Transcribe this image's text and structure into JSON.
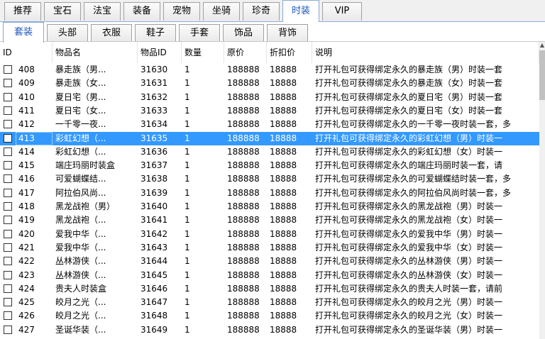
{
  "tabs_primary": [
    {
      "label": "推荐",
      "active": false
    },
    {
      "label": "宝石",
      "active": false
    },
    {
      "label": "法宝",
      "active": false
    },
    {
      "label": "装备",
      "active": false
    },
    {
      "label": "宠物",
      "active": false
    },
    {
      "label": "坐骑",
      "active": false
    },
    {
      "label": "珍奇",
      "active": false
    },
    {
      "label": "时装",
      "active": true
    },
    {
      "label": "VIP",
      "active": false
    }
  ],
  "tabs_secondary": [
    {
      "label": "套装",
      "active": true
    },
    {
      "label": "头部",
      "active": false
    },
    {
      "label": "衣服",
      "active": false
    },
    {
      "label": "鞋子",
      "active": false
    },
    {
      "label": "手套",
      "active": false
    },
    {
      "label": "饰品",
      "active": false
    },
    {
      "label": "背饰",
      "active": false
    }
  ],
  "columns": [
    "ID",
    "物品名",
    "物品ID",
    "数量",
    "原价",
    "折扣价",
    "说明"
  ],
  "selected_id": "413",
  "colors": {
    "selection": "#3399ff",
    "active_tab_text": "#1e58c0"
  },
  "rows": [
    {
      "id": "408",
      "name": "暴走族（男...",
      "item_id": "31630",
      "qty": "1",
      "price": "188888",
      "discount": "18888",
      "desc": "打开礼包可获得绑定永久的暴走族（男）时装一套"
    },
    {
      "id": "409",
      "name": "暴走族（女...",
      "item_id": "31631",
      "qty": "1",
      "price": "188888",
      "discount": "18888",
      "desc": "打开礼包可获得绑定永久的暴走族（女）时装一套"
    },
    {
      "id": "410",
      "name": "夏日宅（男...",
      "item_id": "31632",
      "qty": "1",
      "price": "188888",
      "discount": "18888",
      "desc": "打开礼包可获得绑定永久的夏日宅（男）时装一套"
    },
    {
      "id": "411",
      "name": "夏日宅（女...",
      "item_id": "31633",
      "qty": "1",
      "price": "188888",
      "discount": "18888",
      "desc": "打开礼包可获得绑定永久的夏日宅（女）时装一套"
    },
    {
      "id": "412",
      "name": "一千零一夜...",
      "item_id": "31634",
      "qty": "1",
      "price": "188888",
      "discount": "18888",
      "desc": "打开礼包可获得绑定永久的一千零一夜时装一套，多"
    },
    {
      "id": "413",
      "name": "彩虹幻想（...",
      "item_id": "31635",
      "qty": "1",
      "price": "188888",
      "discount": "18888",
      "desc": "打开礼包可获得绑定永久的彩虹幻想（男）时装一"
    },
    {
      "id": "414",
      "name": "彩虹幻想（...",
      "item_id": "31636",
      "qty": "1",
      "price": "188888",
      "discount": "18888",
      "desc": "打开礼包可获得绑定永久的彩虹幻想（女）时装一"
    },
    {
      "id": "415",
      "name": "端庄玛丽时装盒",
      "item_id": "31637",
      "qty": "1",
      "price": "188888",
      "discount": "18888",
      "desc": "打开礼包可获得绑定永久的端庄玛丽时装一套，请"
    },
    {
      "id": "416",
      "name": "可爱蝴蝶结...",
      "item_id": "31638",
      "qty": "1",
      "price": "188888",
      "discount": "18888",
      "desc": "打开礼包可获得绑定永久的可爱蝴蝶结时装一套，多"
    },
    {
      "id": "417",
      "name": "阿拉伯风尚...",
      "item_id": "31639",
      "qty": "1",
      "price": "188888",
      "discount": "18888",
      "desc": "打开礼包可获得绑定永久的阿拉伯风尚时装一套，多"
    },
    {
      "id": "418",
      "name": "黑龙战袍（男）",
      "item_id": "31640",
      "qty": "1",
      "price": "188888",
      "discount": "18888",
      "desc": "打开礼包可获得绑定永久的黑龙战袍（男）时装一"
    },
    {
      "id": "419",
      "name": "黑龙战袍（...",
      "item_id": "31641",
      "qty": "1",
      "price": "188888",
      "discount": "18888",
      "desc": "打开礼包可获得绑定永久的黑龙战袍（女）时装一"
    },
    {
      "id": "420",
      "name": "爱我中华（...",
      "item_id": "31642",
      "qty": "1",
      "price": "188888",
      "discount": "18888",
      "desc": "打开礼包可获得绑定永久的爱我中华（男）时装一"
    },
    {
      "id": "421",
      "name": "爱我中华（...",
      "item_id": "31643",
      "qty": "1",
      "price": "188888",
      "discount": "18888",
      "desc": "打开礼包可获得绑定永久的爱我中华（女）时装一"
    },
    {
      "id": "422",
      "name": "丛林游侠（...",
      "item_id": "31644",
      "qty": "1",
      "price": "188888",
      "discount": "18888",
      "desc": "打开礼包可获得绑定永久的丛林游侠（男）时装一"
    },
    {
      "id": "423",
      "name": "丛林游侠（...",
      "item_id": "31645",
      "qty": "1",
      "price": "188888",
      "discount": "18888",
      "desc": "打开礼包可获得绑定永久的丛林游侠（女）时装一"
    },
    {
      "id": "424",
      "name": "贵夫人时装盒",
      "item_id": "31646",
      "qty": "1",
      "price": "188888",
      "discount": "18888",
      "desc": "打开礼包可获得绑定永久的贵夫人时装一套，请前"
    },
    {
      "id": "425",
      "name": "皎月之光（...",
      "item_id": "31647",
      "qty": "1",
      "price": "188888",
      "discount": "18888",
      "desc": "打开礼包可获得绑定永久的皎月之光（男）时装一"
    },
    {
      "id": "426",
      "name": "皎月之光（...",
      "item_id": "31648",
      "qty": "1",
      "price": "188888",
      "discount": "18888",
      "desc": "打开礼包可获得绑定永久的皎月之光（女）时装一"
    },
    {
      "id": "427",
      "name": "圣诞华装（...",
      "item_id": "31649",
      "qty": "1",
      "price": "188888",
      "discount": "18888",
      "desc": "打开礼包可获得绑定永久的圣诞华装（男）时装一"
    }
  ]
}
